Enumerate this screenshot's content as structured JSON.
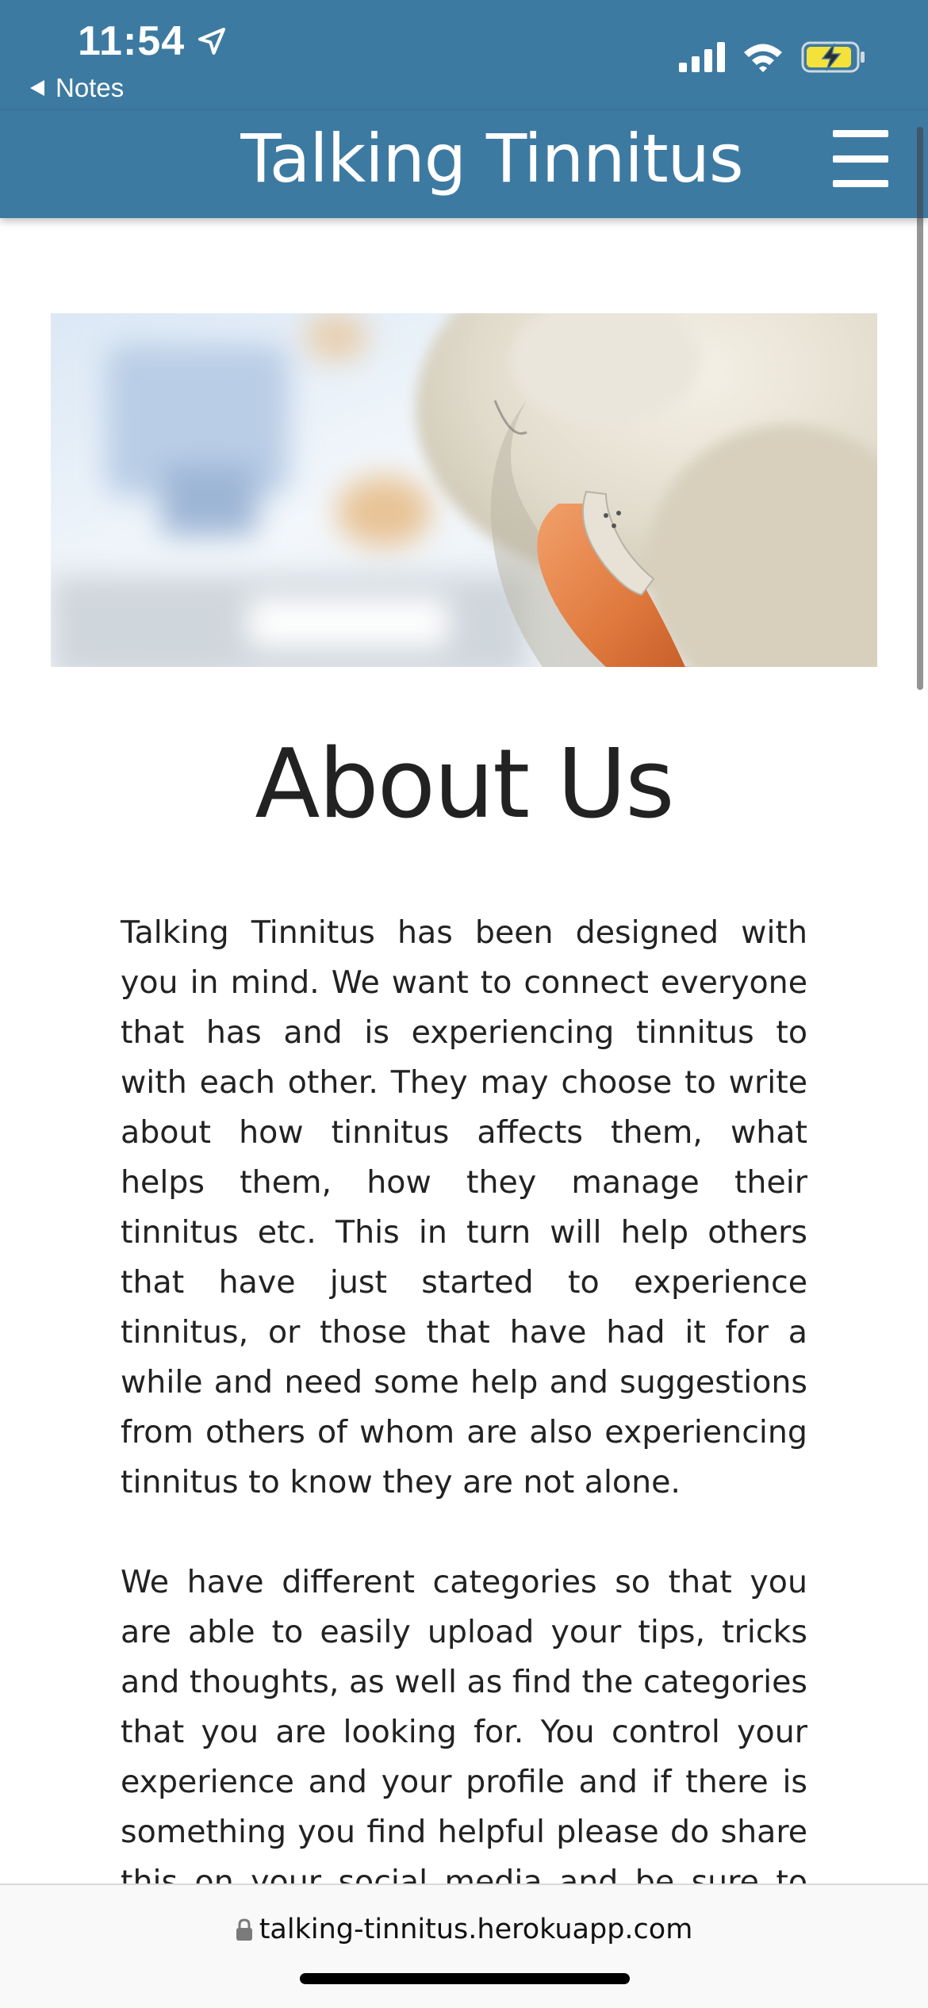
{
  "status_bar": {
    "time": "11:54",
    "back_label": "Notes"
  },
  "header": {
    "site_title": "Talking Tinnitus",
    "menu_icon": "hamburger-menu-icon",
    "background_color": "#3d7aa1"
  },
  "hero_image": {
    "alt": "Close-up of an elderly person's ear wearing a hearing aid"
  },
  "main": {
    "title": "About Us",
    "paragraphs": [
      "Talking Tinnitus has been designed with you in mind. We want to connect everyone that has and is experiencing tinnitus to with each other. They may choose to write about how tinnitus affects them, what helps them, how they manage their tinnitus etc. This in turn will help others that have just started to experience tinnitus, or those that have had it for a while and need some help and suggestions from others of whom are also experiencing tinnitus to know they are not alone.",
      "We have different categories so that you are able to easily upload your tips, tricks and thoughts, as well as find the categories that you are looking for. You control your experience and your profile and if there is something you find helpful please do share this on your social media and be sure to tag"
    ]
  },
  "browser": {
    "url": "talking-tinnitus.herokuapp.com",
    "lock_icon": "lock-icon"
  }
}
